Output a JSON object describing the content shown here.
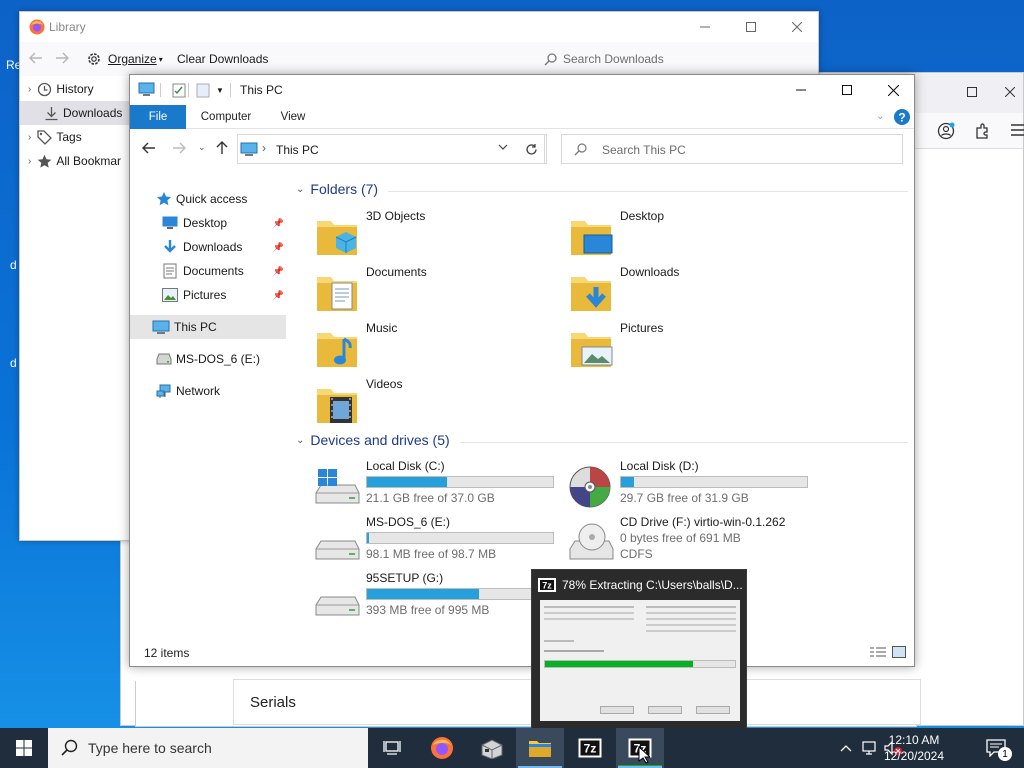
{
  "desktop": {
    "edge_labels": [
      "Re",
      "d",
      "d"
    ]
  },
  "firefox_back": {
    "serials_label": "Serials"
  },
  "library": {
    "title": "Library",
    "organize_label": "Organize",
    "clear_label": "Clear Downloads",
    "search_placeholder": "Search Downloads",
    "sidebar": [
      {
        "label": "History",
        "icon": "history-icon"
      },
      {
        "label": "Downloads",
        "icon": "download-icon"
      },
      {
        "label": "Tags",
        "icon": "tag-icon"
      },
      {
        "label": "All Bookmar",
        "icon": "star-icon"
      }
    ]
  },
  "explorer": {
    "title": "This PC",
    "tabs": {
      "file": "File",
      "computer": "Computer",
      "view": "View"
    },
    "address": "This PC",
    "search_placeholder": "Search This PC",
    "nav": {
      "quick_access": "Quick access",
      "desktop": "Desktop",
      "downloads": "Downloads",
      "documents": "Documents",
      "pictures": "Pictures",
      "this_pc": "This PC",
      "msdos": "MS-DOS_6 (E:)",
      "network": "Network"
    },
    "folders_header": "Folders (7)",
    "folders": {
      "objects3d": "3D Objects",
      "desktop": "Desktop",
      "documents": "Documents",
      "downloads": "Downloads",
      "music": "Music",
      "pictures": "Pictures",
      "videos": "Videos"
    },
    "drives_header": "Devices and drives (5)",
    "drives": {
      "c": {
        "name": "Local Disk (C:)",
        "free": "21.1 GB free of 37.0 GB",
        "used_fraction": 0.43
      },
      "d": {
        "name": "Local Disk (D:)",
        "free": "29.7 GB free of 31.9 GB",
        "used_fraction": 0.07
      },
      "e": {
        "name": "MS-DOS_6 (E:)",
        "free": "98.1 MB free of 98.7 MB",
        "used_fraction": 0.01
      },
      "f": {
        "name": "CD Drive (F:) virtio-win-0.1.262",
        "free": "0 bytes free of 691 MB",
        "fs": "CDFS"
      },
      "g": {
        "name": "95SETUP (G:)",
        "free": "393 MB free of 995 MB",
        "used_fraction": 0.6
      }
    },
    "status": "12 items"
  },
  "sevenzip": {
    "title": "78% Extracting C:\\Users\\balls\\D...",
    "progress": 0.78
  },
  "taskbar": {
    "search_placeholder": "Type here to search",
    "time": "12:10 AM",
    "date": "12/20/2024",
    "notification_count": "1"
  },
  "colors": {
    "accent": "#0a64c8",
    "file_tab": "#1979ca",
    "progress_blue": "#26a0da",
    "zip_green": "#06b025"
  }
}
